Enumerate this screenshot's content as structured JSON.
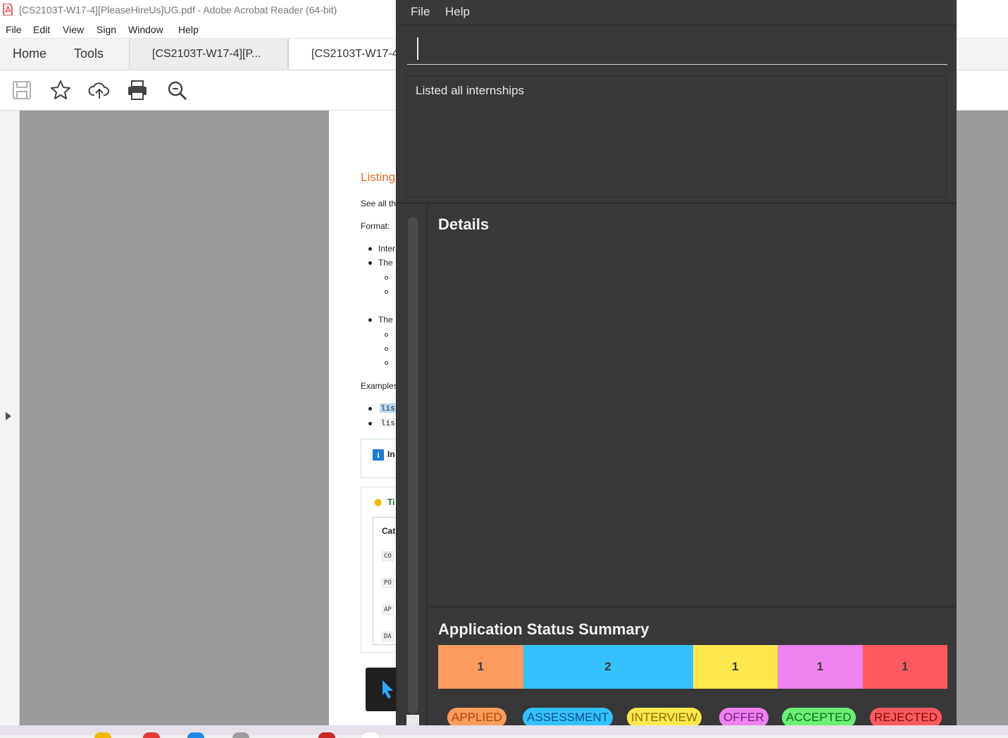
{
  "acrobat": {
    "title": "[CS2103T-W17-4][PleaseHireUs]UG.pdf - Adobe Acrobat Reader (64-bit)",
    "menu": [
      "File",
      "Edit",
      "View",
      "Sign",
      "Window",
      "Help"
    ],
    "tabs": {
      "home": "Home",
      "tools": "Tools",
      "doc1": "[CS2103T-W17-4][P...",
      "doc2": "[CS2103T-W17-4"
    },
    "toolbar_icons": [
      "save-icon",
      "star-icon",
      "upload-icon",
      "print-icon",
      "zoom-icon"
    ],
    "page": {
      "heading": "Listing",
      "line1": "See all th",
      "format": "Format:",
      "b1": "Inter",
      "b2": "The",
      "b3": "The",
      "examples": "Examples",
      "code1": "lis",
      "code2": "lis",
      "info": "In",
      "tip": "Ti",
      "tbl_head": "Cat",
      "tbl_rows": [
        "CO",
        "PO",
        "AP",
        "DA"
      ]
    }
  },
  "app": {
    "menu": {
      "file": "File",
      "help": "Help"
    },
    "command": {
      "value": "",
      "placeholder": ""
    },
    "result": "Listed all internships",
    "details_title": "Details",
    "summary_title": "Application Status Summary",
    "segments": [
      {
        "label": "1",
        "value": 1,
        "color": "#fb9b5e"
      },
      {
        "label": "2",
        "value": 2,
        "color": "#33c2ff"
      },
      {
        "label": "1",
        "value": 1,
        "color": "#ffe74c"
      },
      {
        "label": "1",
        "value": 1,
        "color": "#ee82ee"
      },
      {
        "label": "1",
        "value": 1,
        "color": "#ff5a5f"
      }
    ],
    "legend": [
      {
        "label": "APPLIED",
        "bg": "#fb9b5e",
        "fg": "#b34700"
      },
      {
        "label": "ASSESSMENT",
        "bg": "#33c2ff",
        "fg": "#0b4f8a"
      },
      {
        "label": "INTERVIEW",
        "bg": "#ffe74c",
        "fg": "#8a6a00"
      },
      {
        "label": "OFFER",
        "bg": "#ee82ee",
        "fg": "#7a1a8a"
      },
      {
        "label": "ACCEPTED",
        "bg": "#6bf178",
        "fg": "#136b1a"
      },
      {
        "label": "REJECTED",
        "bg": "#ff5a5f",
        "fg": "#7a0d12"
      }
    ]
  }
}
